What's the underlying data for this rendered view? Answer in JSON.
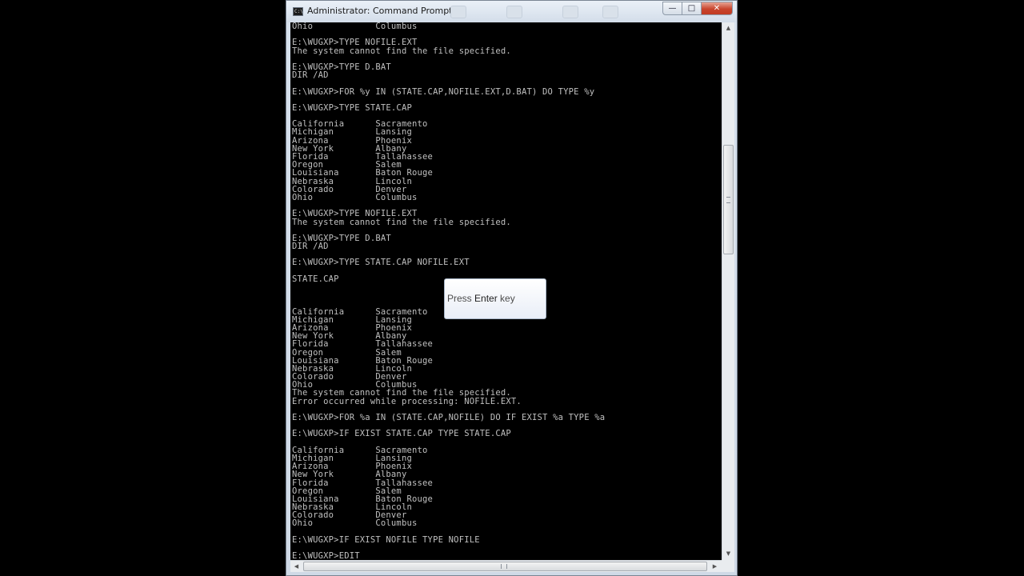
{
  "window": {
    "title": "Administrator: Command Prompt",
    "icon_name": "cmd-icon",
    "controls": {
      "minimize": "minimize-icon",
      "maximize": "maximize-icon",
      "close": "close-icon"
    }
  },
  "console": {
    "lines": [
      "Ohio            Columbus",
      "",
      "E:\\WUGXP>TYPE NOFILE.EXT",
      "The system cannot find the file specified.",
      "",
      "E:\\WUGXP>TYPE D.BAT",
      "DIR /AD",
      "",
      "E:\\WUGXP>FOR %y IN (STATE.CAP,NOFILE.EXT,D.BAT) DO TYPE %y",
      "",
      "E:\\WUGXP>TYPE STATE.CAP",
      "",
      "California      Sacramento",
      "Michigan        Lansing",
      "Arizona         Phoenix",
      "New York        Albany",
      "Florida         Tallahassee",
      "Oregon          Salem",
      "Louisiana       Baton Rouge",
      "Nebraska        Lincoln",
      "Colorado        Denver",
      "Ohio            Columbus",
      "",
      "E:\\WUGXP>TYPE NOFILE.EXT",
      "The system cannot find the file specified.",
      "",
      "E:\\WUGXP>TYPE D.BAT",
      "DIR /AD",
      "",
      "E:\\WUGXP>TYPE STATE.CAP NOFILE.EXT",
      "",
      "STATE.CAP",
      "",
      "",
      "",
      "California      Sacramento",
      "Michigan        Lansing",
      "Arizona         Phoenix",
      "New York        Albany",
      "Florida         Tallahassee",
      "Oregon          Salem",
      "Louisiana       Baton Rouge",
      "Nebraska        Lincoln",
      "Colorado        Denver",
      "Ohio            Columbus",
      "The system cannot find the file specified.",
      "Error occurred while processing: NOFILE.EXT.",
      "",
      "E:\\WUGXP>FOR %a IN (STATE.CAP,NOFILE) DO IF EXIST %a TYPE %a",
      "",
      "E:\\WUGXP>IF EXIST STATE.CAP TYPE STATE.CAP",
      "",
      "California      Sacramento",
      "Michigan        Lansing",
      "Arizona         Phoenix",
      "New York        Albany",
      "Florida         Tallahassee",
      "Oregon          Salem",
      "Louisiana       Baton Rouge",
      "Nebraska        Lincoln",
      "Colorado        Denver",
      "Ohio            Columbus",
      "",
      "E:\\WUGXP>IF EXIST NOFILE TYPE NOFILE",
      "",
      "E:\\WUGXP>EDIT"
    ]
  },
  "tooltip": {
    "prefix": "Press ",
    "key": "Enter",
    "suffix": " key"
  },
  "colors": {
    "console_bg": "#000000",
    "console_text": "#c0c0c0",
    "close_button": "#c8452d"
  }
}
